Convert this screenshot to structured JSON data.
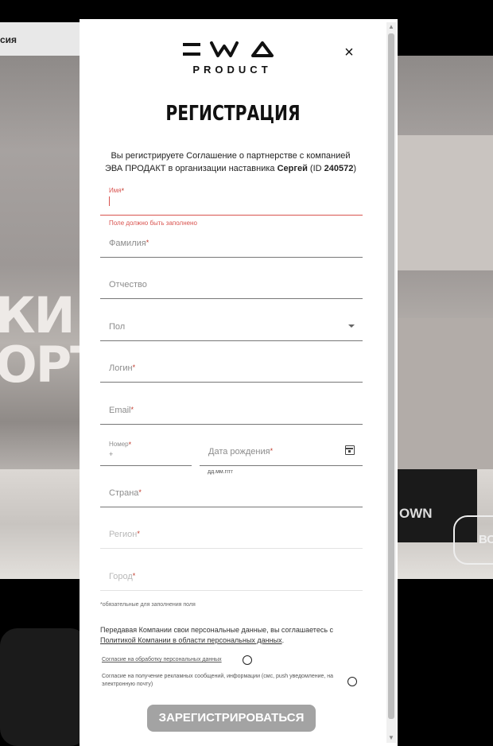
{
  "background": {
    "tab_label": "сия",
    "hero_line1": "КИ С",
    "hero_line2": "ОРТ",
    "box_text": "OWN",
    "button_text": "ВС"
  },
  "modal": {
    "logo_text": "PRODUCT",
    "close_icon": "×",
    "title": "РЕГИСТРАЦИЯ",
    "intro": {
      "text": "Вы регистрируете Соглашение о партнерстве с компанией ЭВА ПРОДАКТ в организации наставника ",
      "mentor": "Сергей",
      "id_prefix": " (ID ",
      "id": "240572",
      "id_suffix": ")"
    },
    "fields": {
      "first_name": "Имя",
      "first_name_error": "Поле должно быть заполнено",
      "last_name": "Фамилия",
      "patronymic": "Отчество",
      "gender": "Пол",
      "login": "Логин",
      "email": "Email",
      "phone": "Номер",
      "phone_prefix": "+",
      "birth_date": "Дата рождения",
      "birth_date_hint": "дд.мм.гггг",
      "country": "Страна",
      "region": "Регион",
      "city": "Город"
    },
    "required_mark": "*",
    "required_note": "обязательные для заполнения поля",
    "consent_text": "Передавая Компании свои персональные данные, вы соглашаетесь с ",
    "consent_link": "Политикой Компании в области персональных данных",
    "consent_end": ".",
    "checkbox_personal": "Согласие на обработку персональных данных",
    "checkbox_ads": "Согласие на получение рекламных сообщений, информации (смс, push уведомление, на электронную почту)",
    "submit_label": "ЗАРЕГИСТРИРОВАТЬСЯ"
  }
}
